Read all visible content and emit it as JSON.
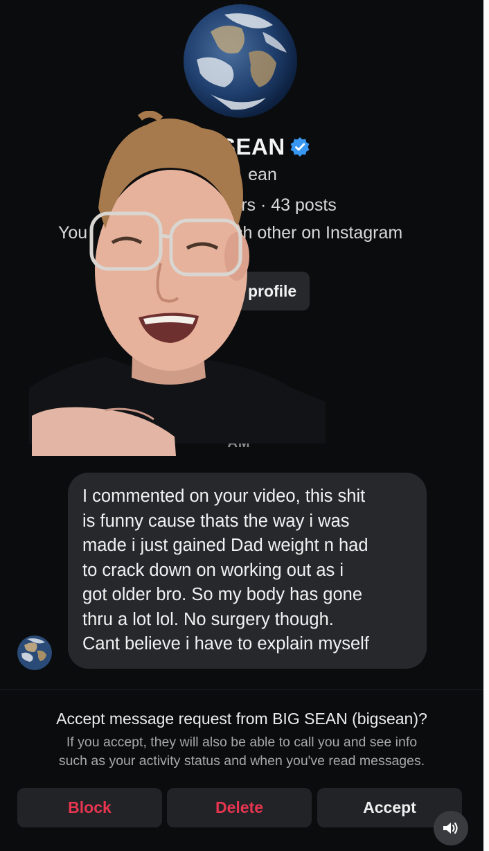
{
  "profile": {
    "name": "SEAN",
    "handle_partial": "ean",
    "stats_partial": "rs · 43 posts",
    "mutual_left": "You",
    "mutual_right": "ch other on Instagram",
    "view_profile_label": "v profile",
    "verified_icon": "verified-badge-icon",
    "avatar_icon": "earth-avatar"
  },
  "timestamp_partial": "AM",
  "message": {
    "lines": [
      "I commented on your video, this shit",
      "is funny cause thats the way i was",
      "made i just gained Dad weight n had",
      "to crack down on working out as i",
      "got older bro. So my body has gone",
      "thru a lot lol. No surgery though.",
      "Cant believe i have to explain myself"
    ]
  },
  "request": {
    "title": "Accept message request from BIG SEAN (bigsean)?",
    "info_line1": "If you accept, they will also be able to call you and see info",
    "info_line2": "such as your activity status and when you've read messages.",
    "block_label": "Block",
    "delete_label": "Delete",
    "accept_label": "Accept"
  },
  "sound_icon": "speaker-icon",
  "colors": {
    "background": "#0b0c0e",
    "bubble": "#26282c",
    "danger": "#e5354f",
    "verified": "#3897f0"
  }
}
